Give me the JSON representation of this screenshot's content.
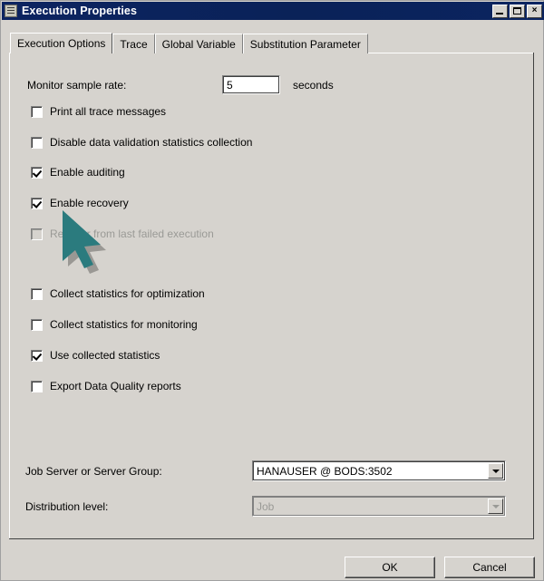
{
  "window": {
    "title": "Execution Properties",
    "icon": "document-icon",
    "controls": {
      "minimize": "minimize-icon",
      "maximize": "maximize-icon",
      "close": "×"
    },
    "titlebar_color": "#0c2461",
    "face_color": "#d6d3ce"
  },
  "tabs": [
    {
      "label": "Execution Options",
      "active": true
    },
    {
      "label": "Trace",
      "active": false
    },
    {
      "label": "Global Variable",
      "active": false
    },
    {
      "label": "Substitution Parameter",
      "active": false
    }
  ],
  "options": {
    "sample_rate": {
      "label": "Monitor sample rate:",
      "value": "5",
      "placeholder": "",
      "unit": "seconds"
    },
    "checkboxes": [
      {
        "label": "Print all trace messages",
        "checked": false,
        "disabled": false
      },
      {
        "label": "Disable data validation statistics collection",
        "checked": false,
        "disabled": false
      },
      {
        "label": "Enable auditing",
        "checked": true,
        "disabled": false
      },
      {
        "label": "Enable recovery",
        "checked": true,
        "disabled": false
      },
      {
        "label": "Recover from last failed execution",
        "checked": false,
        "disabled": true
      },
      {
        "label": "Collect statistics for optimization",
        "checked": false,
        "disabled": false
      },
      {
        "label": "Collect statistics for monitoring",
        "checked": false,
        "disabled": false
      },
      {
        "label": "Use collected statistics",
        "checked": true,
        "disabled": false
      },
      {
        "label": "Export Data Quality reports",
        "checked": false,
        "disabled": false
      }
    ],
    "job_server": {
      "label": "Job Server or Server Group:",
      "value": "HANAUSER @ BODS:3502",
      "disabled": false
    },
    "distribution_level": {
      "label": "Distribution level:",
      "value": "Job",
      "disabled": true
    }
  },
  "footer": {
    "ok_label": "OK",
    "cancel_label": "Cancel"
  },
  "cursor": {
    "name": "arrow-pointer",
    "color": "#2b7b7e"
  }
}
